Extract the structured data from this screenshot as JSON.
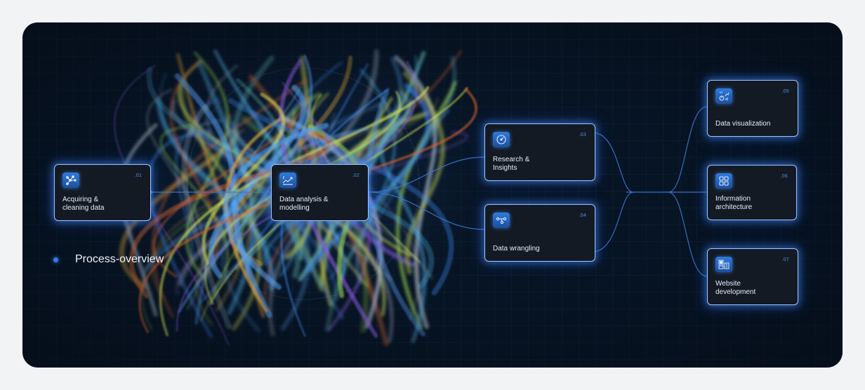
{
  "legend": {
    "label": "Process-overview"
  },
  "nodes": [
    {
      "id": "n1",
      "number": ".01",
      "label": "Acquiring &\ncleaning data",
      "icon": "network-nodes-icon"
    },
    {
      "id": "n2",
      "number": ".02",
      "label": "Data analysis &\nmodelling",
      "icon": "trend-chart-icon"
    },
    {
      "id": "n3",
      "number": ".03",
      "label": "Research &\nInsights",
      "icon": "gauge-icon"
    },
    {
      "id": "n4",
      "number": ".04",
      "label": "Data wrangling",
      "icon": "flow-connectors-icon"
    },
    {
      "id": "n5",
      "number": ".05",
      "label": "Data visualization",
      "icon": "chart-dashboard-icon"
    },
    {
      "id": "n6",
      "number": ".06",
      "label": "Information\narchitecture",
      "icon": "grid-blocks-icon"
    },
    {
      "id": "n7",
      "number": ".07",
      "label": "Website\ndevelopment",
      "icon": "website-layout-icon"
    }
  ],
  "colors": {
    "accent": "#2d7cf0",
    "line": "#3a78d8",
    "background": "#071424",
    "card": "#131a24"
  }
}
